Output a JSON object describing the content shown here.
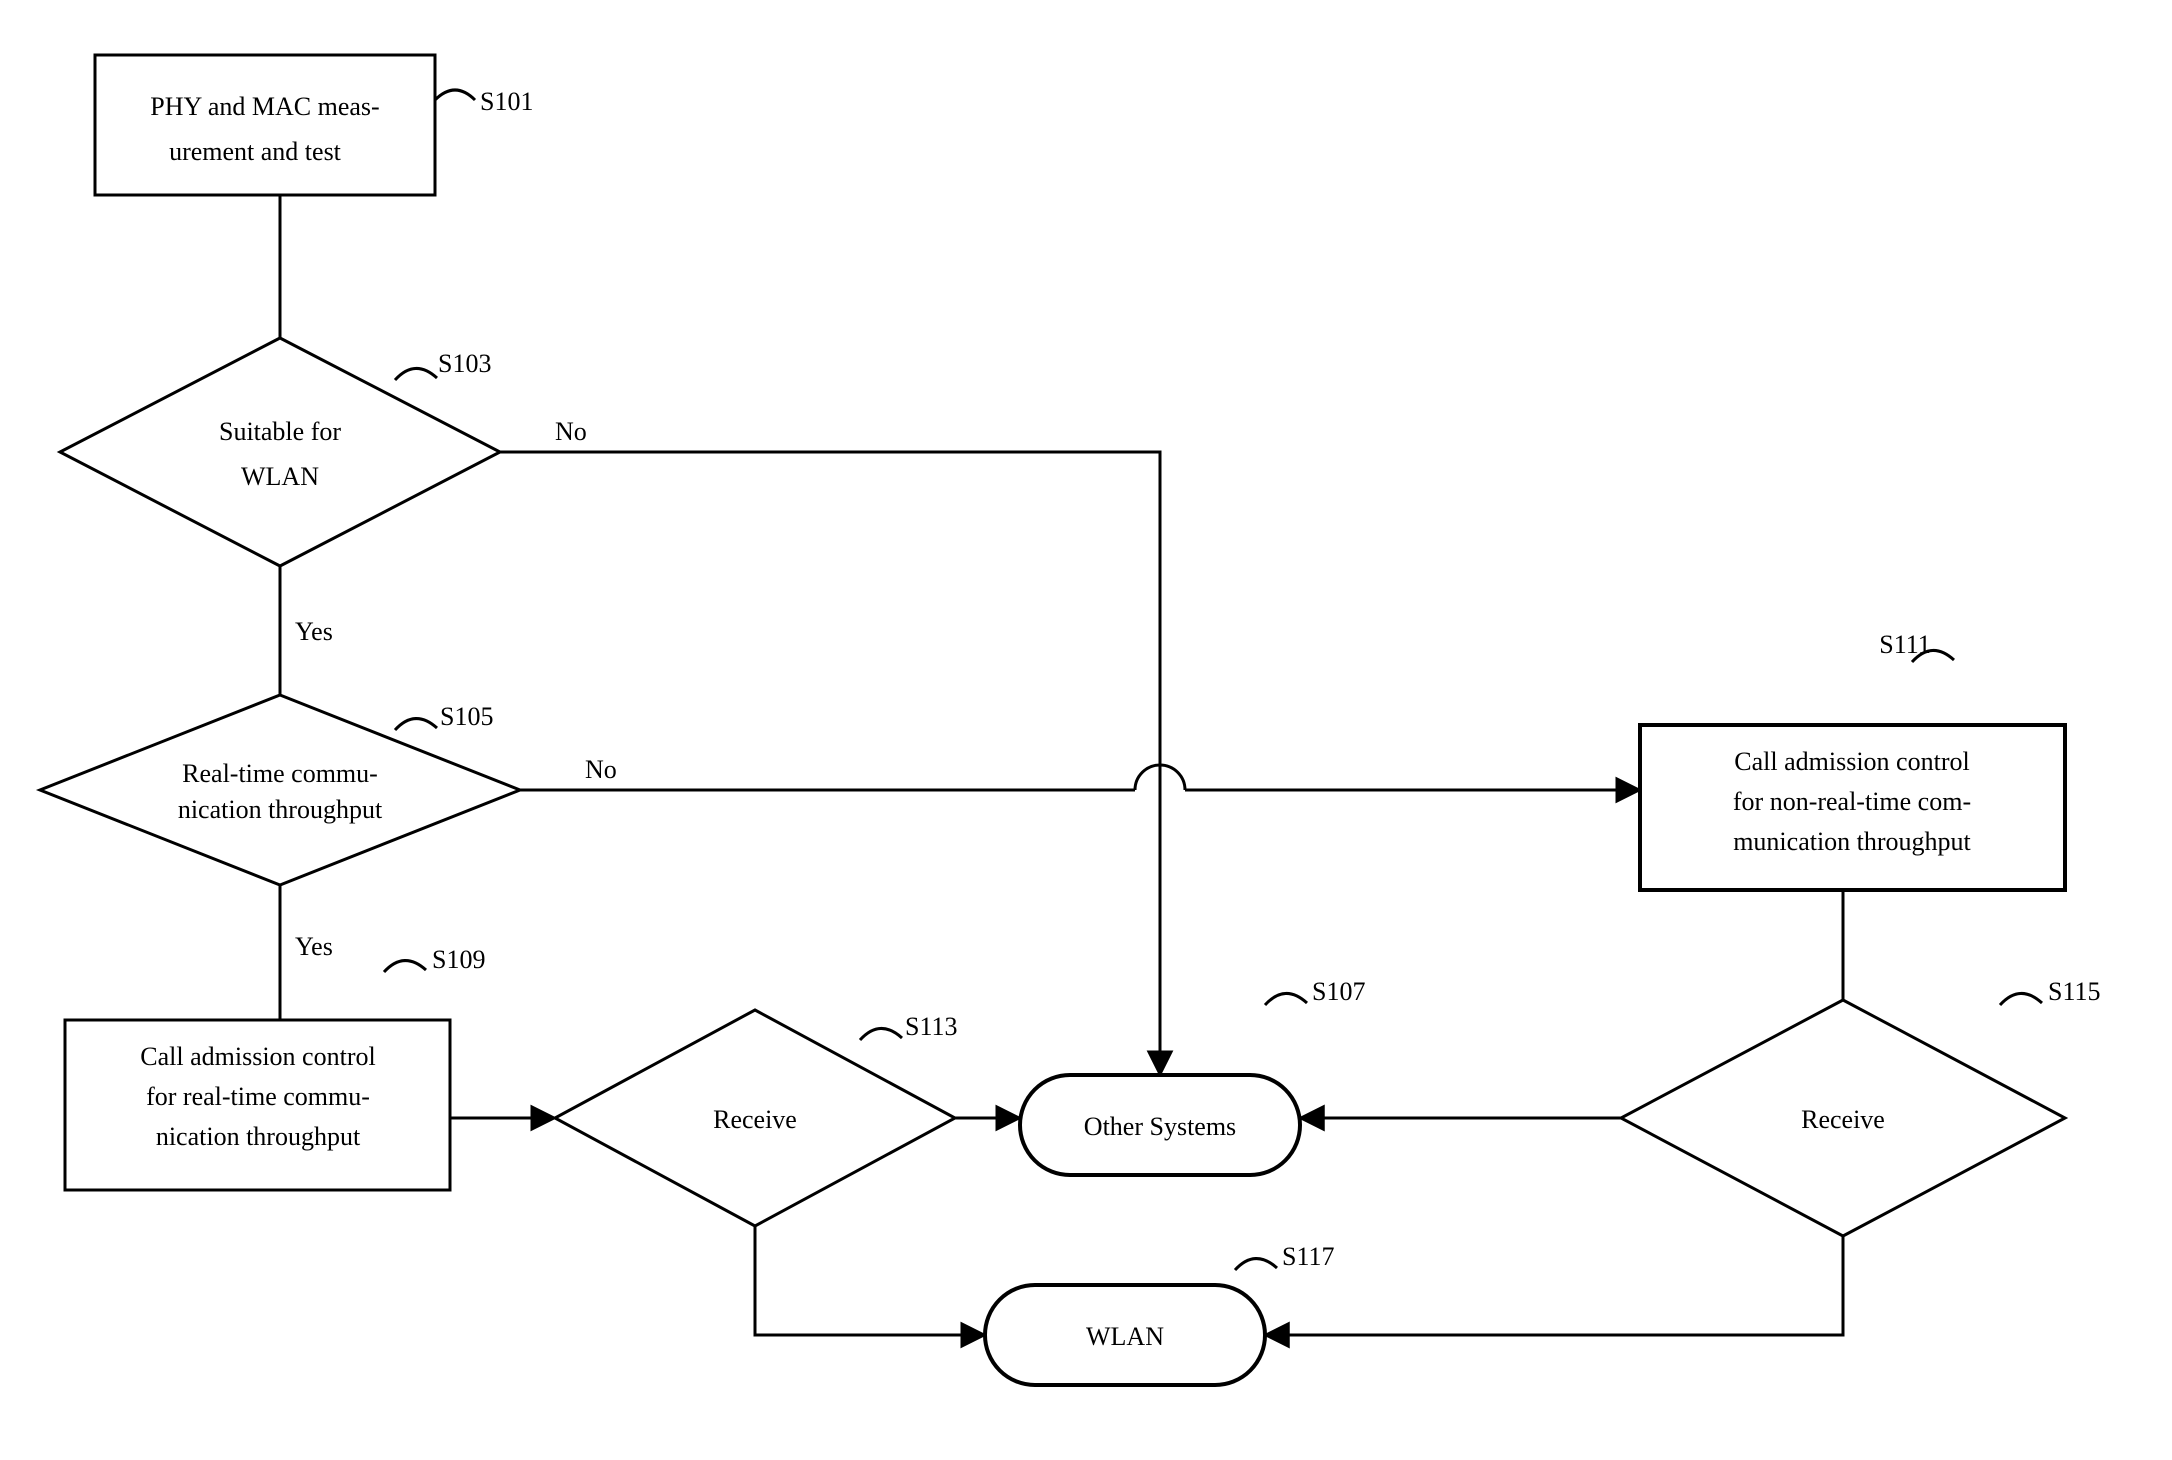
{
  "nodes": {
    "s101": {
      "ref": "S101",
      "l1": "PHY and MAC meas-",
      "l2": "urement and test"
    },
    "s103": {
      "ref": "S103",
      "l1": "Suitable for",
      "l2": "WLAN"
    },
    "s105": {
      "ref": "S105",
      "l1": "Real-time commu-",
      "l2": "nication throughput"
    },
    "s107": {
      "ref": "S107",
      "l1": "Other Systems"
    },
    "s109": {
      "ref": "S109",
      "l1": "Call admission control",
      "l2": "for real-time commu-",
      "l3": "nication throughput"
    },
    "s111": {
      "ref": "S111",
      "l1": "Call admission control",
      "l2": "for non-real-time com-",
      "l3": "munication throughput"
    },
    "s113": {
      "ref": "S113",
      "l1": "Receive"
    },
    "s115": {
      "ref": "S115",
      "l1": "Receive"
    },
    "s117": {
      "ref": "S117",
      "l1": "WLAN"
    }
  },
  "edges": {
    "s103_no": "No",
    "s103_yes": "Yes",
    "s105_no": "No",
    "s105_yes": "Yes"
  }
}
